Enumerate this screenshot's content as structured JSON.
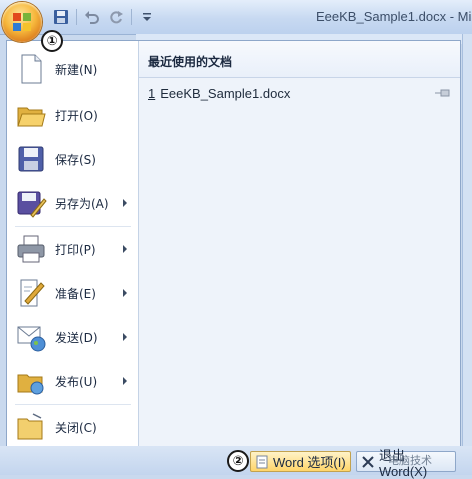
{
  "window": {
    "title": "EeeKB_Sample1.docx - Mi",
    "quick_access": [
      "save-icon",
      "undo-icon",
      "redo-icon",
      "customize-icon"
    ]
  },
  "menu": {
    "items": [
      {
        "label": "新建(N)",
        "icon": "new-document-icon",
        "submenu": false
      },
      {
        "label": "打开(O)",
        "icon": "open-folder-icon",
        "submenu": false
      },
      {
        "label": "保存(S)",
        "icon": "save-disk-icon",
        "submenu": false
      },
      {
        "label": "另存为(A)",
        "icon": "save-as-icon",
        "submenu": true
      },
      {
        "label": "打印(P)",
        "icon": "printer-icon",
        "submenu": true
      },
      {
        "label": "准备(E)",
        "icon": "prepare-icon",
        "submenu": true
      },
      {
        "label": "发送(D)",
        "icon": "send-icon",
        "submenu": true
      },
      {
        "label": "发布(U)",
        "icon": "publish-icon",
        "submenu": true
      },
      {
        "label": "关闭(C)",
        "icon": "close-folder-icon",
        "submenu": false
      }
    ]
  },
  "recent": {
    "header": "最近使用的文档",
    "items": [
      {
        "num": "1",
        "name": "EeeKB_Sample1.docx"
      }
    ]
  },
  "buttons": {
    "options_label": "Word 选项(I)",
    "exit_label": "退出 Word(X)"
  },
  "markers": {
    "one": "①",
    "two": "②"
  },
  "watermark": "电脑技术"
}
